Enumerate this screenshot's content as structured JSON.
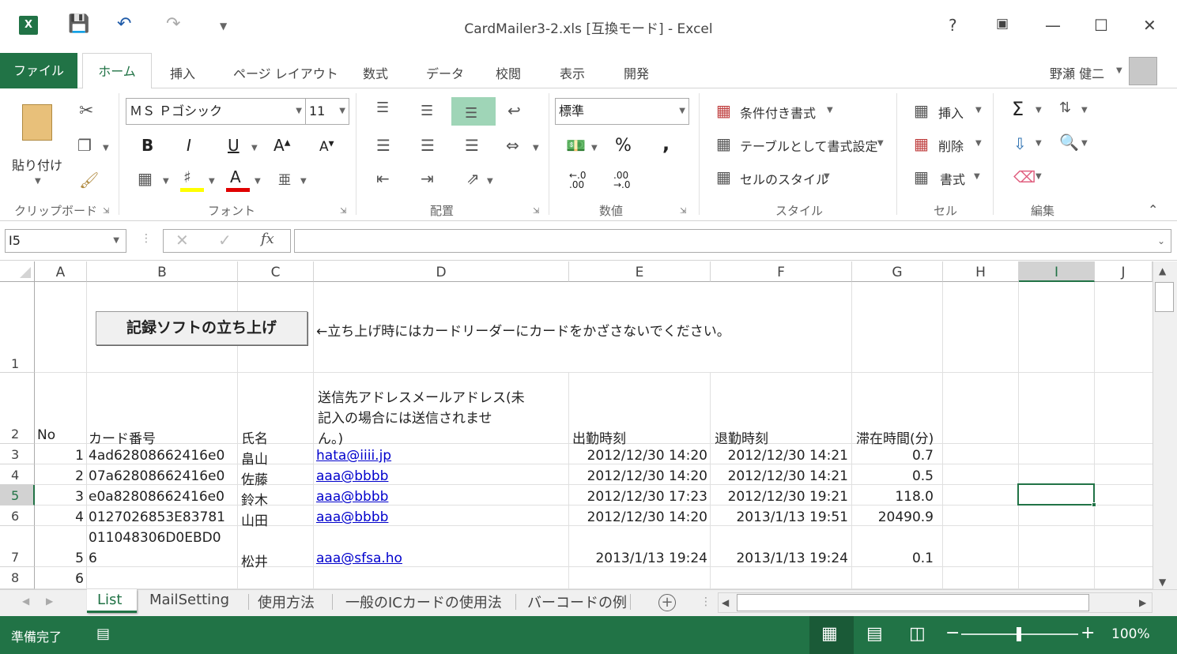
{
  "window": {
    "title": "CardMailer3-2.xls  [互換モード] - Excel",
    "help": "?",
    "user": "野瀬 健二"
  },
  "tabs": {
    "file": "ファイル",
    "home": "ホーム",
    "insert": "挿入",
    "page_layout": "ページ レイアウト",
    "formulas": "数式",
    "data": "データ",
    "review": "校閲",
    "view": "表示",
    "developer": "開発"
  },
  "ribbon": {
    "clipboard": {
      "paste": "貼り付け",
      "label": "クリップボード"
    },
    "font": {
      "name": "ＭＳ Ｐゴシック",
      "size": "11",
      "bold": "B",
      "italic": "I",
      "underline": "U",
      "label": "フォント"
    },
    "alignment": {
      "label": "配置"
    },
    "number": {
      "format": "標準",
      "percent": "%",
      "comma": ",",
      "label": "数値"
    },
    "styles": {
      "conditional": "条件付き書式",
      "table": "テーブルとして書式設定",
      "cell_styles": "セルのスタイル",
      "label": "スタイル"
    },
    "cells": {
      "insert": "挿入",
      "delete": "削除",
      "format": "書式",
      "label": "セル"
    },
    "editing": {
      "label": "編集"
    }
  },
  "formula_bar": {
    "name_box": "I5",
    "fx": "fx",
    "content": ""
  },
  "columns": [
    "A",
    "B",
    "C",
    "D",
    "E",
    "F",
    "G",
    "H",
    "I",
    "J"
  ],
  "sheet": {
    "button": "記録ソフトの立ち上げ",
    "note": "←立ち上げ時にはカードリーダーにカードをかざさないでください。",
    "headers": {
      "no": "No",
      "card": "カード番号",
      "name": "氏名",
      "email_line1": "送信先アドレスメールアドレス(未",
      "email_line2": "記入の場合には送信されませ",
      "email_line3": "ん。)",
      "in": "出勤時刻",
      "out": "退勤時刻",
      "stay": "滞在時間(分)"
    },
    "rows": [
      {
        "row": "3",
        "no": "1",
        "card": "4ad62808662416e0",
        "name": "畠山",
        "email": "hata@iiii.jp",
        "in": "2012/12/30 14:20",
        "out": "2012/12/30 14:21",
        "stay": "0.7"
      },
      {
        "row": "4",
        "no": "2",
        "card": "07a62808662416e0",
        "name": "佐藤",
        "email": "aaa@bbbb",
        "in": "2012/12/30 14:20",
        "out": "2012/12/30 14:21",
        "stay": "0.5"
      },
      {
        "row": "5",
        "no": "3",
        "card": "e0a82808662416e0",
        "name": "鈴木",
        "email": "aaa@bbbb",
        "in": "2012/12/30 17:23",
        "out": "2012/12/30 19:21",
        "stay": "118.0"
      },
      {
        "row": "6",
        "no": "4",
        "card": "0127026853E83781",
        "name": "山田",
        "email": "aaa@bbbb",
        "in": "2012/12/30 14:20",
        "out": "2013/1/13 19:51",
        "stay": "20490.9"
      },
      {
        "row": "7",
        "no": "5",
        "card_line1": "011048306D0EBD0",
        "card_line2": "6",
        "name": "松井",
        "email": "aaa@sfsa.ho",
        "in": "2013/1/13 19:24",
        "out": "2013/1/13 19:24",
        "stay": "0.1"
      },
      {
        "row": "8",
        "no": "6"
      }
    ],
    "row_numbers": [
      "1",
      "2"
    ]
  },
  "sheet_tabs": [
    "List",
    "MailSetting",
    "使用方法",
    "一般のICカードの使用法",
    "バーコードの例"
  ],
  "status": {
    "ready": "準備完了",
    "zoom": "100%"
  },
  "colors": {
    "accent": "#217346",
    "link": "#0000cc"
  }
}
